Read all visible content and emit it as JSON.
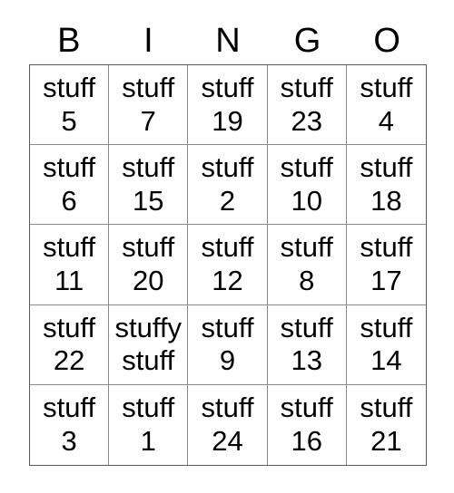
{
  "card": {
    "title": "BINGO",
    "background_color": "#ffffff",
    "text_color": "#000000",
    "grid_line_color": "#8a8a8a",
    "outer_border_color": "#5a5a5a"
  },
  "header": {
    "letters": [
      "B",
      "I",
      "N",
      "G",
      "O"
    ]
  },
  "grid": {
    "columns": 5,
    "rows": 5,
    "free_space_index": 16,
    "cells": [
      "stuff 5",
      "stuff 7",
      "stuff 19",
      "stuff 23",
      "stuff 4",
      "stuff 6",
      "stuff 15",
      "stuff 2",
      "stuff 10",
      "stuff 18",
      "stuff 11",
      "stuff 20",
      "stuff 12",
      "stuff 8",
      "stuff 17",
      "stuff 22",
      "stuffy stuff",
      "stuff 9",
      "stuff 13",
      "stuff 14",
      "stuff 3",
      "stuff 1",
      "stuff 24",
      "stuff 16",
      "stuff 21"
    ]
  }
}
